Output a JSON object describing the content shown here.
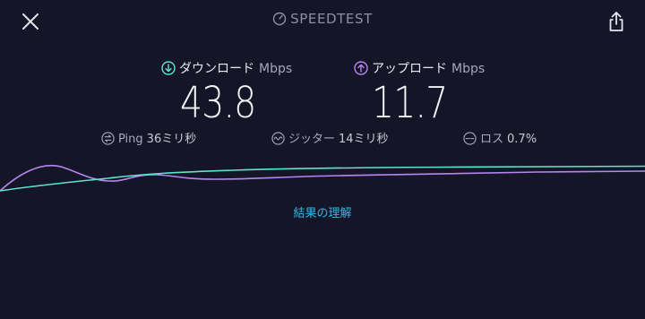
{
  "header": {
    "brand": "SPEEDTEST",
    "close_icon": "close-icon",
    "share_icon": "share-icon"
  },
  "download": {
    "label": "ダウンロード",
    "unit": "Mbps",
    "value": "43.8",
    "icon": "download-arrow-icon",
    "color": "#5fe3c8"
  },
  "upload": {
    "label": "アップロード",
    "unit": "Mbps",
    "value": "11.7",
    "icon": "upload-arrow-icon",
    "color": "#b784f0"
  },
  "stats": {
    "ping": {
      "label": "Ping",
      "value": "36ミリ秒",
      "icon": "ping-icon"
    },
    "jitter": {
      "label": "ジッター",
      "value": "14ミリ秒",
      "icon": "jitter-icon"
    },
    "loss": {
      "label": "ロス",
      "value": "0.7%",
      "icon": "loss-icon"
    }
  },
  "results_link": "結果の理解",
  "colors": {
    "background": "#151528",
    "link": "#37b6e5",
    "download_line": "#5fe3c8",
    "upload_line": "#b784f0"
  }
}
